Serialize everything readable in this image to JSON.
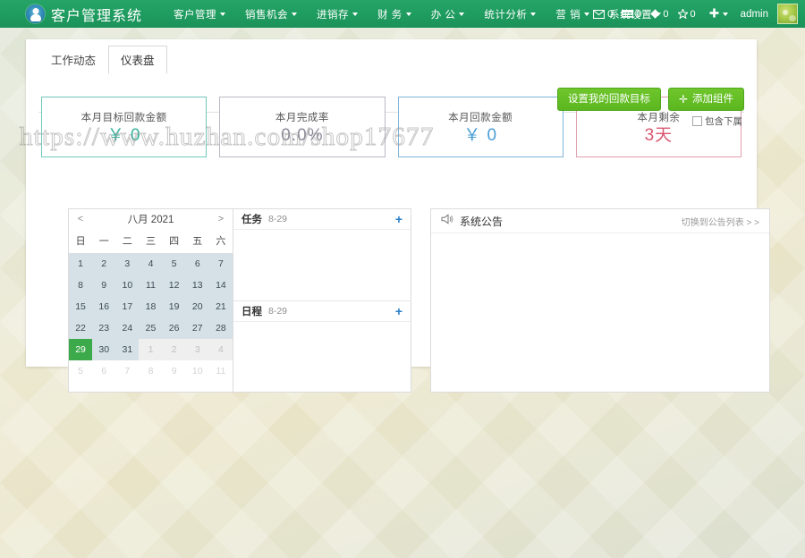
{
  "header": {
    "brand": "客户管理系统",
    "logo_icon": "user-circle-logo-icon",
    "nav": [
      {
        "label": "客户管理",
        "icon": "chevron-down-icon"
      },
      {
        "label": "销售机会",
        "icon": "chevron-down-icon"
      },
      {
        "label": "进销存",
        "icon": "chevron-down-icon"
      },
      {
        "label": "财 务",
        "icon": "chevron-down-icon"
      },
      {
        "label": "办 公",
        "icon": "chevron-down-icon"
      },
      {
        "label": "统计分析",
        "icon": "chevron-down-icon"
      },
      {
        "label": "营 销",
        "icon": "chevron-down-icon"
      },
      {
        "label": "系统设置",
        "icon": "chevron-down-icon"
      }
    ],
    "stats": [
      {
        "icon": "envelope-icon",
        "count": "0"
      },
      {
        "icon": "list-icon",
        "count": "0"
      },
      {
        "icon": "diamond-icon",
        "count": "0"
      },
      {
        "icon": "star-icon",
        "count": "0"
      }
    ],
    "add_icon": "plus-icon",
    "add_caret_icon": "chevron-down-icon",
    "username": "admin",
    "avatar_icon": "avatar-icon"
  },
  "panel": {
    "tabs": [
      {
        "label": "工作动态",
        "active": false
      },
      {
        "label": "仪表盘",
        "active": true
      }
    ],
    "actions": {
      "set_goal_label": "设置我的回款目标",
      "add_widget_label": "添加组件",
      "add_widget_icon": "plus-icon"
    },
    "subordinate_option": {
      "label": "包含下属",
      "checked": false
    }
  },
  "cards": [
    {
      "label": "本月目标回款金额",
      "value": "￥ 0",
      "theme": "teal"
    },
    {
      "label": "本月完成率",
      "value": "0.0%",
      "theme": "gray"
    },
    {
      "label": "本月回款金额",
      "value": "￥ 0",
      "theme": "blue"
    },
    {
      "label": "本月剩余",
      "value": "3天",
      "theme": "pink"
    }
  ],
  "calendar": {
    "prev_icon": "chevron-left-icon",
    "next_icon": "chevron-right-icon",
    "title": "八月 2021",
    "weekdays": [
      "日",
      "一",
      "二",
      "三",
      "四",
      "五",
      "六"
    ],
    "weeks": [
      [
        {
          "d": "1",
          "t": "in"
        },
        {
          "d": "2",
          "t": "in"
        },
        {
          "d": "3",
          "t": "in"
        },
        {
          "d": "4",
          "t": "in"
        },
        {
          "d": "5",
          "t": "in"
        },
        {
          "d": "6",
          "t": "in"
        },
        {
          "d": "7",
          "t": "in"
        }
      ],
      [
        {
          "d": "8",
          "t": "in"
        },
        {
          "d": "9",
          "t": "in"
        },
        {
          "d": "10",
          "t": "in"
        },
        {
          "d": "11",
          "t": "in"
        },
        {
          "d": "12",
          "t": "in"
        },
        {
          "d": "13",
          "t": "in"
        },
        {
          "d": "14",
          "t": "in"
        }
      ],
      [
        {
          "d": "15",
          "t": "in"
        },
        {
          "d": "16",
          "t": "in"
        },
        {
          "d": "17",
          "t": "in"
        },
        {
          "d": "18",
          "t": "in"
        },
        {
          "d": "19",
          "t": "in"
        },
        {
          "d": "20",
          "t": "in"
        },
        {
          "d": "21",
          "t": "in"
        }
      ],
      [
        {
          "d": "22",
          "t": "in"
        },
        {
          "d": "23",
          "t": "in"
        },
        {
          "d": "24",
          "t": "in"
        },
        {
          "d": "25",
          "t": "in"
        },
        {
          "d": "26",
          "t": "in"
        },
        {
          "d": "27",
          "t": "in"
        },
        {
          "d": "28",
          "t": "in"
        }
      ],
      [
        {
          "d": "29",
          "t": "today"
        },
        {
          "d": "30",
          "t": "in"
        },
        {
          "d": "31",
          "t": "in"
        },
        {
          "d": "1",
          "t": "other"
        },
        {
          "d": "2",
          "t": "other"
        },
        {
          "d": "3",
          "t": "other"
        },
        {
          "d": "4",
          "t": "other"
        }
      ],
      [
        {
          "d": "5",
          "t": "blank"
        },
        {
          "d": "6",
          "t": "blank"
        },
        {
          "d": "7",
          "t": "blank"
        },
        {
          "d": "8",
          "t": "blank"
        },
        {
          "d": "9",
          "t": "blank"
        },
        {
          "d": "10",
          "t": "blank"
        },
        {
          "d": "11",
          "t": "blank"
        }
      ]
    ]
  },
  "tasks": [
    {
      "title": "任务",
      "date": "8-29",
      "add_icon": "plus-icon"
    },
    {
      "title": "日程",
      "date": "8-29",
      "add_icon": "plus-icon"
    }
  ],
  "announcement": {
    "icon": "megaphone-icon",
    "title": "系统公告",
    "link": "切换到公告列表 > >"
  },
  "watermark": {
    "text": "https://www.huzhan.com/shop17677"
  },
  "colors": {
    "brand_green": "#1f9d60",
    "button_green": "#5bb61f",
    "today_green": "#3caa4a",
    "card_teal": "#36b39e",
    "card_gray": "#8a8a99",
    "card_blue": "#4a9ed6",
    "card_pink": "#d9566e",
    "link_blue": "#2a7fc9"
  }
}
